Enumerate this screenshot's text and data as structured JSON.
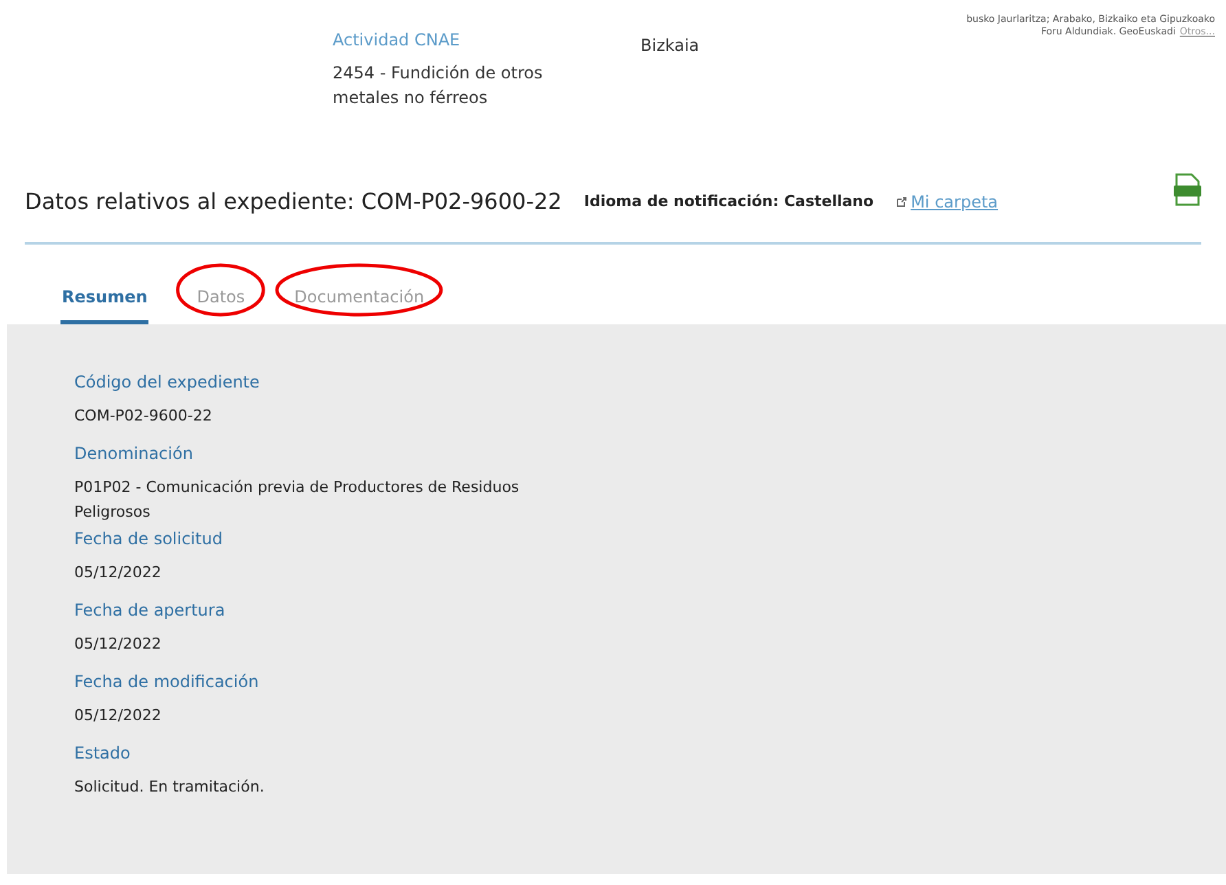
{
  "top": {
    "activity_label": "Actividad CNAE",
    "activity_value": "2454 - Fundición de otros metales no férreos",
    "province": "Bizkaia",
    "credits_line1": "busko Jaurlaritza; Arabako, Bizkaiko eta Gipuzkoako",
    "credits_line2": "Foru Aldundiak. GeoEuskadi",
    "credits_link": "Otros..."
  },
  "header": {
    "title": "Datos relativos al expediente: COM-P02-9600-22",
    "language": "Idioma de notificación: Castellano",
    "folder_link": "Mi carpeta"
  },
  "tabs": [
    {
      "label": "Resumen",
      "selected": true,
      "circled": false
    },
    {
      "label": "Datos",
      "selected": false,
      "circled": true
    },
    {
      "label": "Documentación",
      "selected": false,
      "circled": true
    }
  ],
  "fields": [
    {
      "label": "Código del expediente",
      "value": "COM-P02-9600-22"
    },
    {
      "label": "Denominación",
      "value": "P01P02 - Comunicación previa de Productores de Residuos Peligrosos"
    },
    {
      "label": "Fecha de solicitud",
      "value": "05/12/2022"
    },
    {
      "label": "Fecha de apertura",
      "value": "05/12/2022"
    },
    {
      "label": "Fecha de modificación",
      "value": "05/12/2022"
    },
    {
      "label": "Estado",
      "value": "Solicitud. En tramitación."
    }
  ]
}
